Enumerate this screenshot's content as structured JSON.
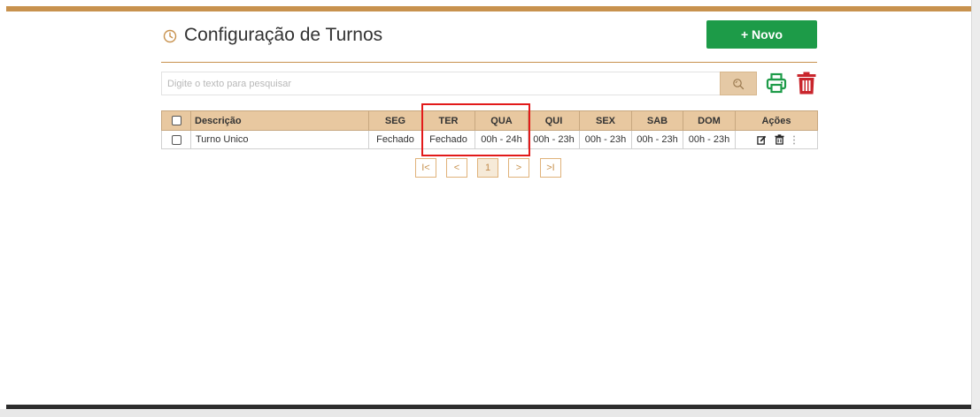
{
  "page": {
    "title": "Configuração de Turnos",
    "new_button_label": "+ Novo"
  },
  "search": {
    "placeholder": "Digite o texto para pesquisar"
  },
  "table": {
    "headers": {
      "description": "Descrição",
      "seg": "SEG",
      "ter": "TER",
      "qua": "QUA",
      "qui": "QUI",
      "sex": "SEX",
      "sab": "SAB",
      "dom": "DOM",
      "actions": "Ações"
    },
    "rows": [
      {
        "description": "Turno Unico",
        "seg": "Fechado",
        "ter": "Fechado",
        "qua": "00h - 24h",
        "qui": "00h - 23h",
        "sex": "00h - 23h",
        "sab": "00h - 23h",
        "dom": "00h - 23h"
      }
    ]
  },
  "pagination": {
    "first": "I<",
    "prev": "<",
    "current": "1",
    "next": ">",
    "last": ">I"
  },
  "colors": {
    "accent": "#c8924e",
    "header_bg": "#e8c8a0",
    "new_button": "#1d9b48",
    "print_icon": "#1d9b48",
    "trash_icon": "#c9252c",
    "highlight": "#e21a1a"
  },
  "icons": {
    "title": "clock-icon",
    "search": "search-icon",
    "print": "printer-icon",
    "delete_all": "trash-icon",
    "row_edit": "edit-icon",
    "row_delete": "trash-icon",
    "row_more": "more-vertical-icon"
  }
}
